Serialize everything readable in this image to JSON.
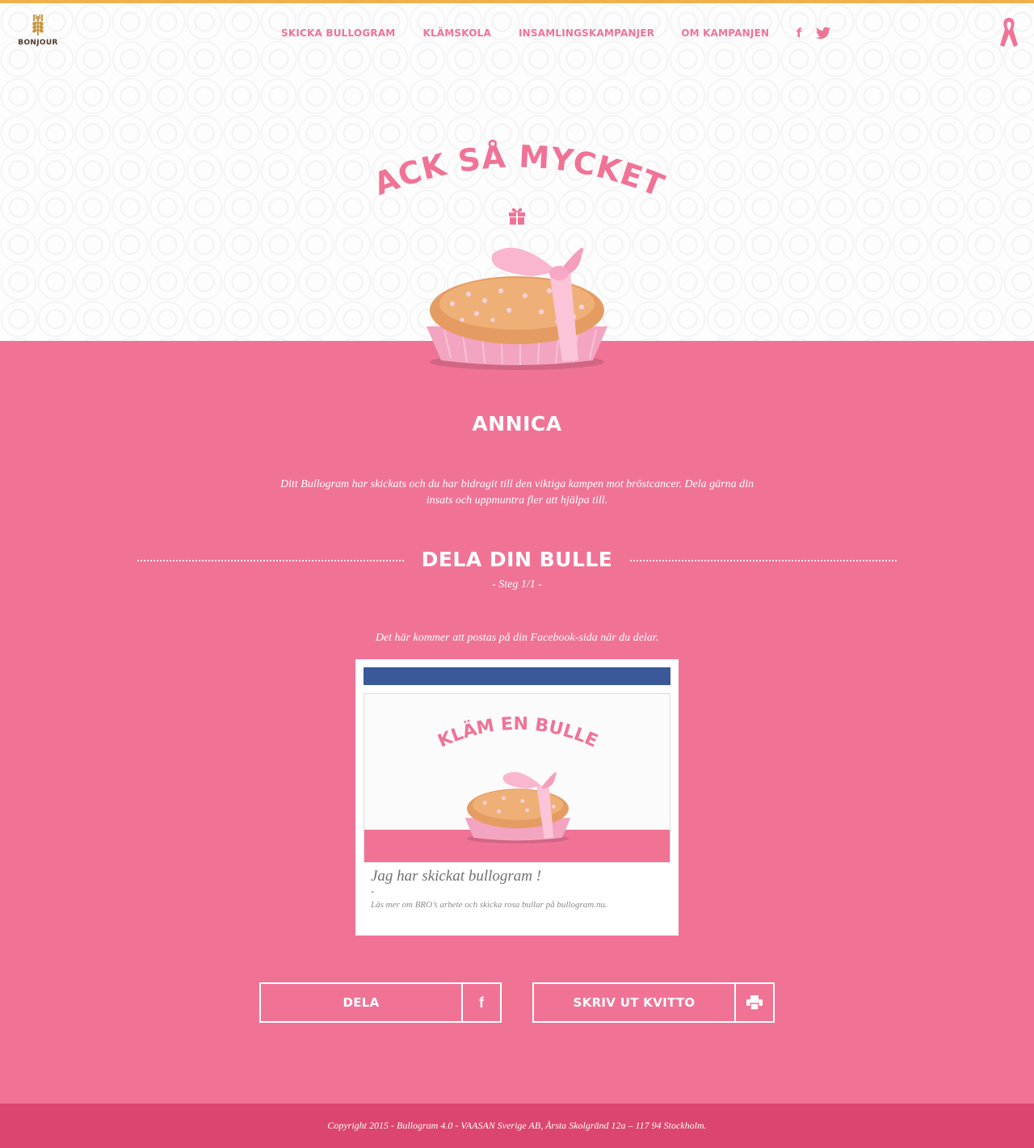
{
  "brand": {
    "logo_text": "BONJOUR",
    "accent": "#f07396",
    "top_bar": "#efb14b",
    "footer_bg": "#dc456f",
    "facebook_blue": "#3b5998"
  },
  "nav": {
    "items": [
      {
        "label": "SKICKA BULLOGRAM"
      },
      {
        "label": "KLÄMSKOLA"
      },
      {
        "label": "INSAMLINGSKAMPANJER"
      },
      {
        "label": "OM KAMPANJEN"
      }
    ],
    "social": [
      {
        "icon": "facebook-icon",
        "glyph": "f"
      },
      {
        "icon": "twitter-icon"
      }
    ]
  },
  "hero": {
    "title": "TACK SÅ MYCKET!"
  },
  "recipient": {
    "name": "ANNICA"
  },
  "thanks": {
    "text": "Ditt Bullogram har skickats och du har bidragit till den viktiga kampen mot bröstcancer. Dela gärna din insats och uppmuntra fler att hjälpa till."
  },
  "share": {
    "title": "DELA DIN BULLE",
    "step": "- Steg 1/1 -",
    "note": "Det här kommer att postas på din Facebook-sida när du delar."
  },
  "preview": {
    "image_title": "KLÄM EN BULLE",
    "headline": "Jag har skickat bullogram !",
    "dash": "-",
    "description": "Läs mer om BRO’s arbete och skicka rosa bullar på bullogram.nu."
  },
  "buttons": {
    "share_label": "DELA",
    "share_icon_glyph": "f",
    "print_label": "SKRIV UT KVITTO"
  },
  "footer": {
    "text": "Copyright 2015 - Bullogram 4.0 - VAASAN Sverige AB, Årsta Skolgränd 12a – 117 94 Stockholm."
  }
}
